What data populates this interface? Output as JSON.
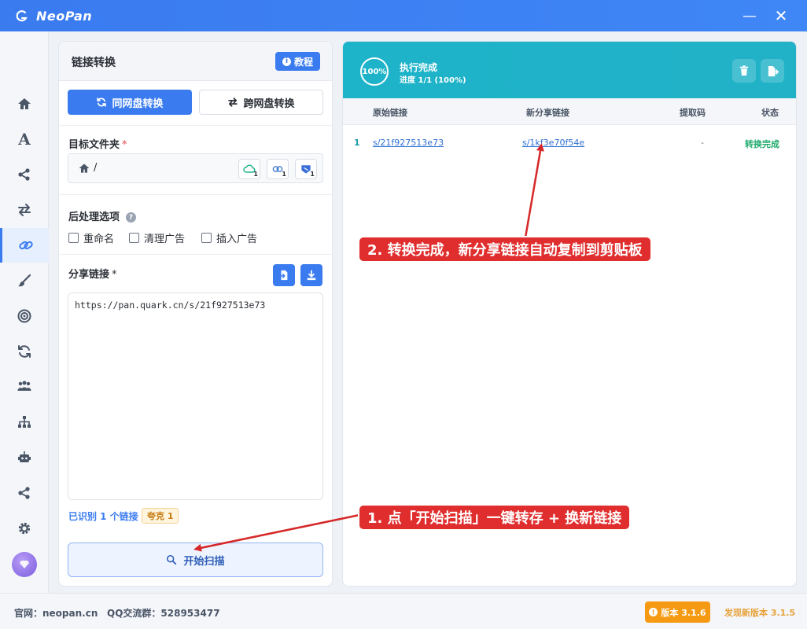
{
  "app": {
    "title": "NeoPan",
    "minimize_label": "—",
    "close_label": "✕"
  },
  "left_panel": {
    "title": "链接转换",
    "tutorial_label": "教程",
    "mode_same_label": "同网盘转换",
    "mode_cross_label": "跨网盘转换",
    "target_folder_label": "目标文件夹",
    "required_mark": "*",
    "folder_path": "/",
    "cloud_badges": [
      "1",
      "1",
      "1"
    ],
    "post_options_label": "后处理选项",
    "help_mark": "?",
    "options": [
      {
        "label": "重命名",
        "checked": false
      },
      {
        "label": "清理广告",
        "checked": false
      },
      {
        "label": "插入广告",
        "checked": false
      }
    ],
    "share_link_label": "分享链接",
    "share_link_text": "https://pan.quark.cn/s/21f927513e73",
    "detected_text": "已识别 1 个链接",
    "quark_badge": "夸克 1",
    "scan_label": "开始扫描"
  },
  "right_panel": {
    "progress_percent": "100%",
    "status_title": "执行完成",
    "status_sub": "进度 1/1 (100%)",
    "columns": [
      "原始链接",
      "新分享链接",
      "提取码",
      "状态"
    ],
    "rows": [
      {
        "index": "1",
        "original": "s/21f927513e73",
        "new_link": "s/1kf3e70f54e",
        "code": "-",
        "status": "转换完成"
      }
    ]
  },
  "annotations": {
    "step1": "1. 点「开始扫描」一键转存 + 换新链接",
    "step2": "2. 转换完成，新分享链接自动复制到剪贴板"
  },
  "statusbar": {
    "site": "官网：neopan.cn",
    "qq": "QQ交流群：528953477",
    "version_label": "版本 3.1.6",
    "new_version": "发现新版本 3.1.5"
  },
  "colors": {
    "accent": "#3a7bf0",
    "header_teal": "#1db3c9",
    "success": "#1faa6b",
    "annotation": "#e02d2d",
    "version": "#f59a12"
  }
}
